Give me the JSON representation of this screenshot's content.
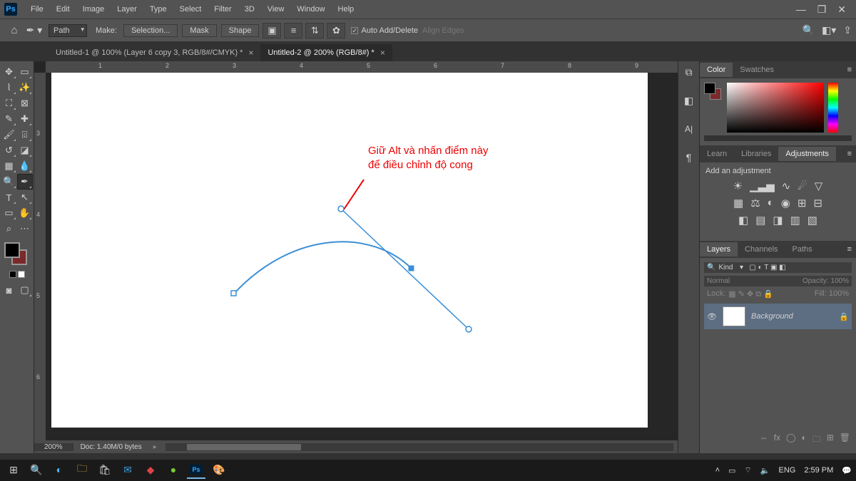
{
  "app": {
    "logo_text": "Ps"
  },
  "menu": [
    "File",
    "Edit",
    "Image",
    "Layer",
    "Type",
    "Select",
    "Filter",
    "3D",
    "View",
    "Window",
    "Help"
  ],
  "options": {
    "mode": "Path",
    "make_label": "Make:",
    "selection_btn": "Selection...",
    "mask_btn": "Mask",
    "shape_btn": "Shape",
    "auto_add_delete": "Auto Add/Delete",
    "align_edges": "Align Edges"
  },
  "tabs": [
    {
      "label": "Untitled-1 @ 100% (Layer 6 copy 3, RGB/8#/CMYK) *",
      "active": false
    },
    {
      "label": "Untitled-2 @ 200% (RGB/8#) *",
      "active": true
    }
  ],
  "ruler_h": [
    "1",
    "2",
    "3",
    "4",
    "5",
    "6",
    "7",
    "8",
    "9"
  ],
  "ruler_v": [
    "3",
    "4",
    "5",
    "6"
  ],
  "annotation": {
    "line1": "Giữ Alt và nhấn điểm này",
    "line2": "để điều chỉnh độ cong"
  },
  "zoom": "200%",
  "doc_info": "Doc: 1.40M/0 bytes",
  "panel_color": {
    "tabs": [
      "Color",
      "Swatches"
    ]
  },
  "panel_adj": {
    "tabs": [
      "Learn",
      "Libraries",
      "Adjustments"
    ],
    "hint": "Add an adjustment"
  },
  "panel_layers": {
    "tabs": [
      "Layers",
      "Channels",
      "Paths"
    ],
    "kind": "Kind",
    "blend": "Normal",
    "opacity_label": "Opacity:",
    "opacity": "100%",
    "lock_label": "Lock:",
    "fill_label": "Fill:",
    "fill": "100%",
    "layer_name": "Background"
  },
  "taskbar": {
    "lang": "ENG",
    "time": "2:59 PM"
  }
}
